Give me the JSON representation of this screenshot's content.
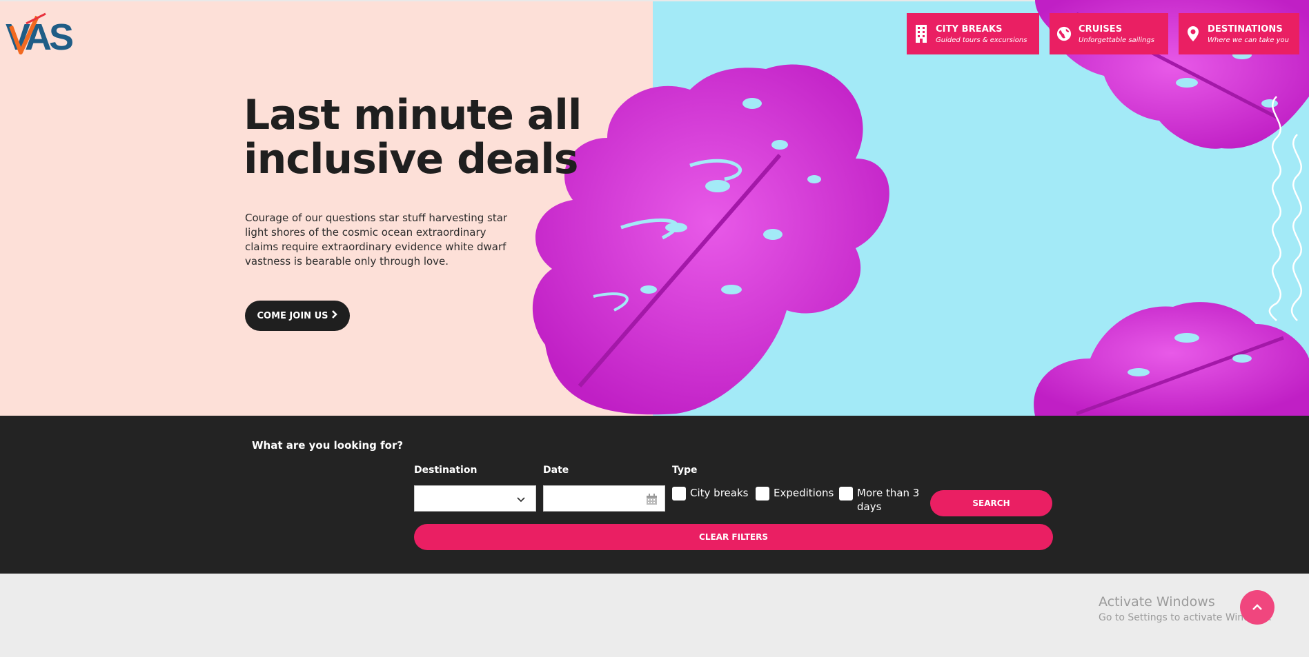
{
  "brand": {
    "logo_text": "VAS"
  },
  "nav": [
    {
      "title": "CITY BREAKS",
      "subtitle": "Guided tours & excursions",
      "icon": "building-icon"
    },
    {
      "title": "CRUISES",
      "subtitle": "Unforgettable sailings",
      "icon": "globe-icon"
    },
    {
      "title": "DESTINATIONS",
      "subtitle": "Where we can take you",
      "icon": "map-pin-icon"
    }
  ],
  "hero": {
    "headline_line1": "Last minute all",
    "headline_line2": "inclusive deals",
    "body": "Courage of our questions star stuff harvesting star light shores of the cosmic ocean extraordinary claims require extraordinary evidence white dwarf vastness is bearable only through love.",
    "cta_label": "COME JOIN US"
  },
  "search": {
    "heading": "What are you looking for?",
    "destination_label": "Destination",
    "destination_value": "",
    "date_label": "Date",
    "date_value": "",
    "type_label": "Type",
    "types": [
      "City breaks",
      "Expeditions",
      "More than 3 days"
    ],
    "search_label": "SEARCH",
    "clear_label": "CLEAR FILTERS"
  },
  "overlay": {
    "activate_title": "Activate Windows",
    "activate_sub": "Go to Settings to activate Windows."
  },
  "colors": {
    "accent": "#ea1f63",
    "hero_left_bg": "#fde0d8",
    "hero_right_bg": "#a3eaf7",
    "leaf": "#d42ad6",
    "dark": "#232323"
  }
}
